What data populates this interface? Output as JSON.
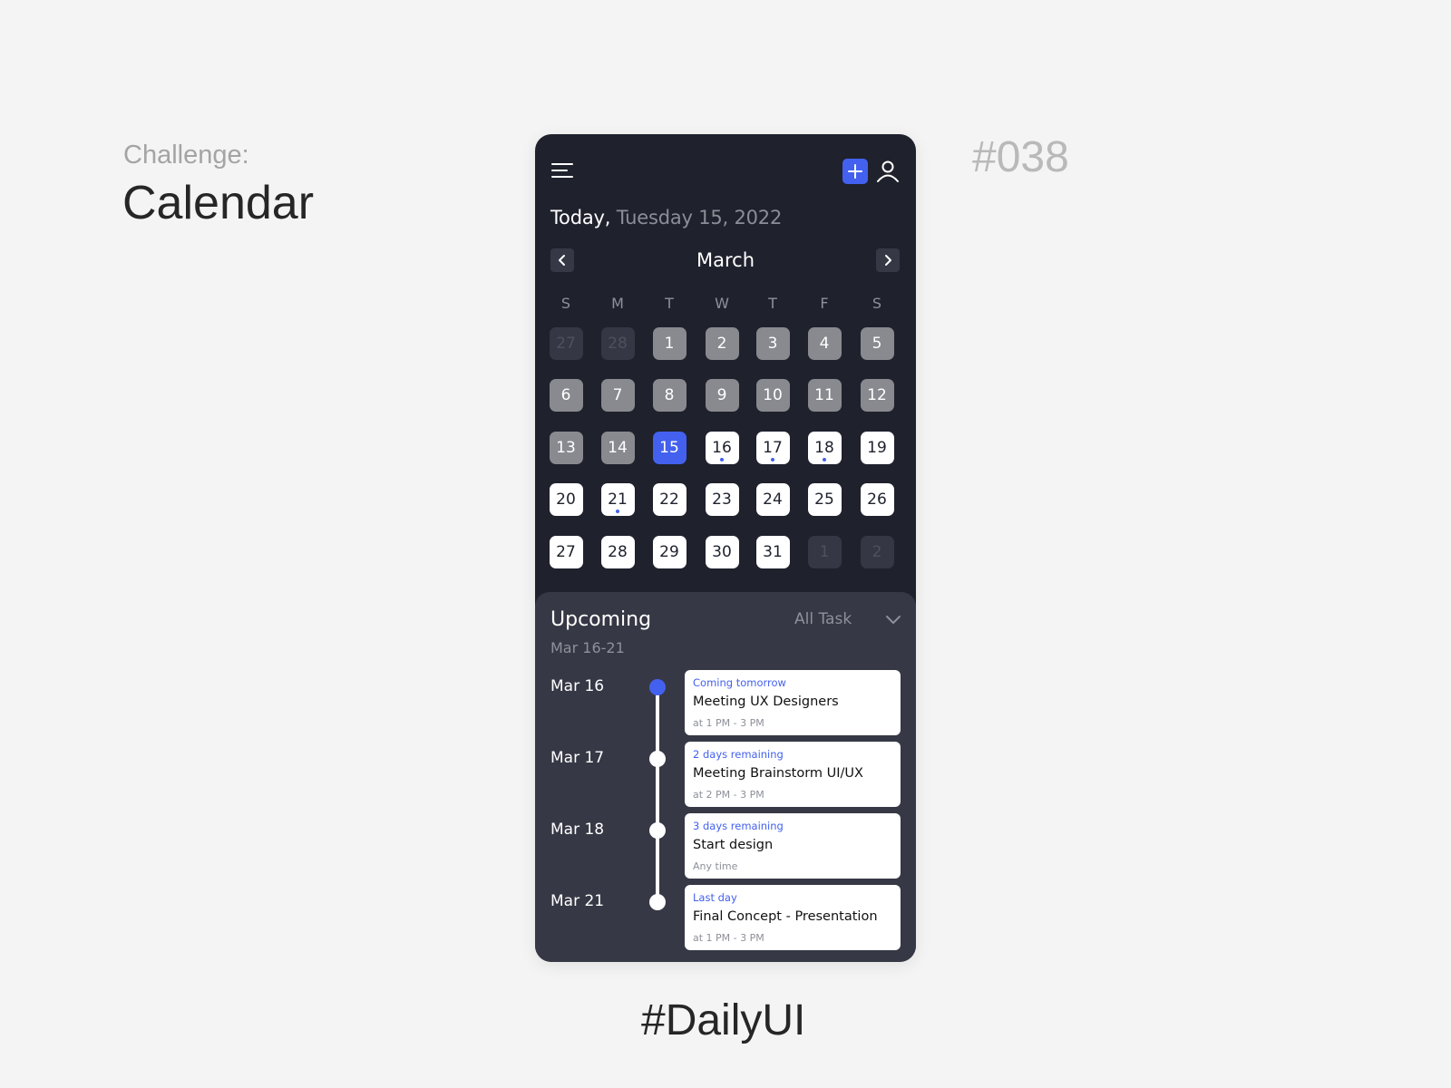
{
  "page": {
    "challenge_label": "Challenge:",
    "challenge_title": "Calendar",
    "challenge_number": "#038",
    "footer_tag": "#DailyUI"
  },
  "app": {
    "header": {
      "menu_icon": "hamburger-menu-icon",
      "add_icon": "plus-icon",
      "profile_icon": "user-icon"
    },
    "today_prefix": "Today,",
    "today_date": " Tuesday 15, 2022",
    "month": "March",
    "prev_icon": "chevron-left-icon",
    "next_icon": "chevron-right-icon",
    "weekdays": [
      "S",
      "M",
      "T",
      "W",
      "T",
      "F",
      "S"
    ],
    "accent_color": "#4361ee",
    "weeks": [
      [
        {
          "d": "27",
          "s": "outside"
        },
        {
          "d": "28",
          "s": "outside"
        },
        {
          "d": "1",
          "s": "past"
        },
        {
          "d": "2",
          "s": "past"
        },
        {
          "d": "3",
          "s": "past"
        },
        {
          "d": "4",
          "s": "past"
        },
        {
          "d": "5",
          "s": "past"
        }
      ],
      [
        {
          "d": "6",
          "s": "past"
        },
        {
          "d": "7",
          "s": "past"
        },
        {
          "d": "8",
          "s": "past"
        },
        {
          "d": "9",
          "s": "past"
        },
        {
          "d": "10",
          "s": "past"
        },
        {
          "d": "11",
          "s": "past"
        },
        {
          "d": "12",
          "s": "past"
        }
      ],
      [
        {
          "d": "13",
          "s": "past"
        },
        {
          "d": "14",
          "s": "past"
        },
        {
          "d": "15",
          "s": "today"
        },
        {
          "d": "16",
          "s": "future",
          "event": true
        },
        {
          "d": "17",
          "s": "future",
          "event": true
        },
        {
          "d": "18",
          "s": "future",
          "event": true
        },
        {
          "d": "19",
          "s": "future"
        }
      ],
      [
        {
          "d": "20",
          "s": "future"
        },
        {
          "d": "21",
          "s": "future",
          "event": true
        },
        {
          "d": "22",
          "s": "future"
        },
        {
          "d": "23",
          "s": "future"
        },
        {
          "d": "24",
          "s": "future"
        },
        {
          "d": "25",
          "s": "future"
        },
        {
          "d": "26",
          "s": "future"
        }
      ],
      [
        {
          "d": "27",
          "s": "future"
        },
        {
          "d": "28",
          "s": "future"
        },
        {
          "d": "29",
          "s": "future"
        },
        {
          "d": "30",
          "s": "future"
        },
        {
          "d": "31",
          "s": "future"
        },
        {
          "d": "1",
          "s": "outside"
        },
        {
          "d": "2",
          "s": "outside"
        }
      ]
    ],
    "upcoming": {
      "title": "Upcoming",
      "range": "Mar 16-21",
      "filter": "All Task",
      "filter_icon": "chevron-down-icon",
      "events": [
        {
          "date": "Mar 16",
          "status": "Coming tomorrow",
          "title": "Meeting UX Designers",
          "time": "at 1 PM - 3 PM",
          "active": true
        },
        {
          "date": "Mar 17",
          "status": "2 days remaining",
          "title": "Meeting Brainstorm UI/UX",
          "time": "at 2 PM - 3 PM",
          "active": false
        },
        {
          "date": "Mar 18",
          "status": "3 days remaining",
          "title": "Start design",
          "time": "Any time",
          "active": false
        },
        {
          "date": "Mar 21",
          "status": "Last day",
          "title": "Final Concept - Presentation",
          "time": "at 1 PM - 3 PM",
          "active": false
        }
      ]
    }
  }
}
